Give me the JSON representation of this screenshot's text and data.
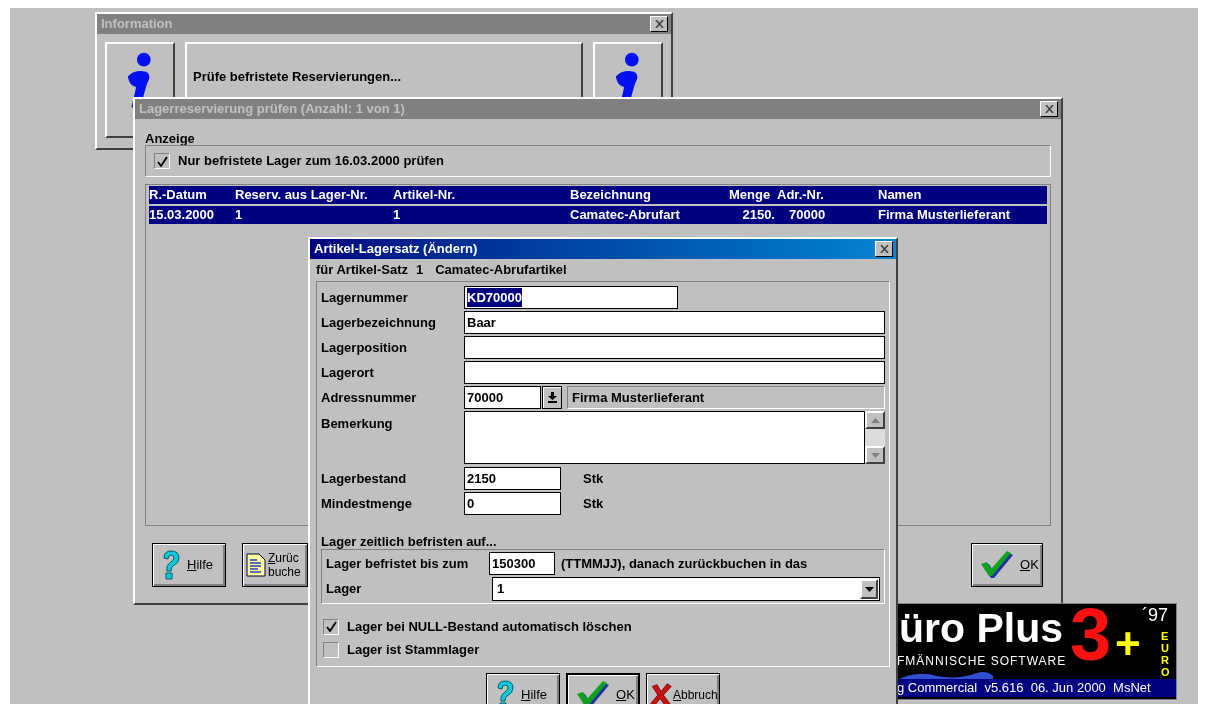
{
  "info_window": {
    "title": "Information",
    "active": false,
    "message": "Prüfe befristete Reservierungen..."
  },
  "reservation_window": {
    "title": "Lagerreservierung prüfen (Anzahl: 1 von 1)",
    "active": false,
    "section": "Anzeige",
    "filter": {
      "label": "Nur befristete Lager zum 16.03.2000 prüfen",
      "checked": true
    },
    "table": {
      "columns": [
        "R.-Datum",
        "Reserv. aus Lager-Nr.",
        "Artikel-Nr.",
        "Bezeichnung",
        "Menge",
        "Adr.-Nr.",
        "Namen"
      ],
      "rows": [
        {
          "cells": [
            "15.03.2000",
            "1",
            "1",
            "Camatec-Abrufart",
            "2150.",
            "70000",
            "Firma Musterlieferant"
          ],
          "selected": true
        }
      ]
    },
    "buttons": [
      {
        "kind": "help",
        "lines": [
          "Hilfe"
        ]
      },
      {
        "kind": "book",
        "lines": [
          "Zurüc",
          "buche"
        ]
      },
      {
        "kind": "ok",
        "lines": [
          "OK"
        ]
      }
    ]
  },
  "dialog": {
    "title": "Artikel-Lagersatz (Ändern)",
    "active": true,
    "record_label": "für Artikel-Satz",
    "record_number": "1",
    "record_name": "Camatec-Abrufartikel",
    "fields": [
      {
        "kind": "short",
        "label": "Lagernummer",
        "value": "KD70000",
        "highlighted": true
      },
      {
        "kind": "text",
        "label": "Lagerbezeichnung",
        "value": "Baar"
      },
      {
        "kind": "text",
        "label": "Lagerposition"
      },
      {
        "kind": "text",
        "label": "Lagerort"
      },
      {
        "kind": "lookup",
        "label": "Adressnummer",
        "value": "70000",
        "display": "Firma Musterlieferant"
      },
      {
        "kind": "memo",
        "label": "Bemerkung"
      },
      {
        "kind": "quantity",
        "label": "Lagerbestand",
        "value": "2150",
        "unit": "Stk"
      },
      {
        "kind": "quantity",
        "label": "Mindestmenge",
        "value": "0",
        "unit": "Stk"
      }
    ],
    "expiry": {
      "heading": "Lager zeitlich befristen auf...",
      "until_label": "Lager befristet bis zum",
      "until_value": "150300",
      "hint": "(TTMMJJ), danach zurückbuchen in das",
      "store_label": "Lager",
      "store_value": "1"
    },
    "options": [
      {
        "label": "Lager bei NULL-Bestand automatisch löschen",
        "checked": true
      },
      {
        "label": "Lager ist Stammlager",
        "checked": false
      }
    ],
    "buttons": [
      {
        "kind": "help",
        "lines": [
          "Hilfe"
        ],
        "default": false
      },
      {
        "kind": "ok",
        "lines": [
          "OK"
        ],
        "default": true
      },
      {
        "kind": "cancel",
        "lines": [
          "Abbruch"
        ],
        "default": false
      }
    ]
  },
  "logo": {
    "brand": "üro Plus",
    "tagline": "FMÄNNISCHE SOFTWARE",
    "year": "´97",
    "number": "3",
    "plus": "+",
    "currency": "EURO",
    "status": "g Commercial  v5.616  06. Jun 2000  MsNet"
  }
}
